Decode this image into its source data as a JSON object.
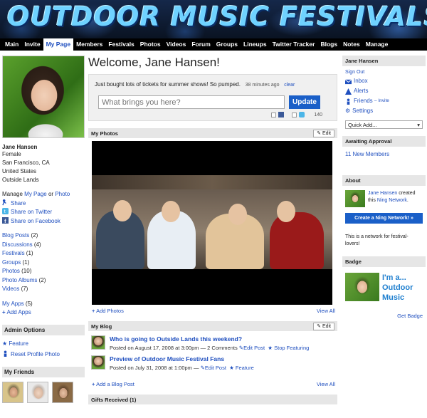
{
  "banner": {
    "title": "OUTDOOR MUSIC FESTIVALS"
  },
  "nav": [
    "Main",
    "Invite",
    "My Page",
    "Members",
    "Festivals",
    "Photos",
    "Videos",
    "Forum",
    "Groups",
    "Lineups",
    "Twitter Tracker",
    "Blogs",
    "Notes",
    "Manage"
  ],
  "nav_active": "My Page",
  "profile": {
    "name": "Jane Hansen",
    "gender": "Female",
    "city": "San Francisco, CA",
    "country": "United States",
    "extra": "Outside Lands",
    "manage_prefix": "Manage",
    "manage_page": "My Page",
    "manage_or": "or",
    "manage_photo": "Photo",
    "share": "Share",
    "share_twitter": "Share on Twitter",
    "share_facebook": "Share on Facebook"
  },
  "content_links": [
    {
      "label": "Blog Posts",
      "count": "(2)"
    },
    {
      "label": "Discussions",
      "count": "(4)"
    },
    {
      "label": "Festivals",
      "count": "(1)"
    },
    {
      "label": "Groups",
      "count": "(1)"
    },
    {
      "label": "Photos",
      "count": "(10)"
    },
    {
      "label": "Photo Albums",
      "count": "(2)"
    },
    {
      "label": "Videos",
      "count": "(7)"
    }
  ],
  "apps": {
    "my_apps": "My Apps",
    "my_apps_count": "(5)",
    "add_apps": "Add Apps"
  },
  "admin": {
    "title": "Admin Options",
    "feature": "Feature",
    "reset": "Reset Profile Photo"
  },
  "friends": {
    "title": "My Friends"
  },
  "welcome": "Welcome, Jane Hansen!",
  "status": {
    "text": "Just bought lots of tickets for summer shows! So pumped.",
    "time": "38 minutes ago",
    "clear": "clear",
    "placeholder": "What brings you here?",
    "update": "Update",
    "count": "140"
  },
  "photos_module": {
    "title": "My Photos",
    "edit": "Edit",
    "add": "Add Photos",
    "view_all": "View All"
  },
  "blog_module": {
    "title": "My Blog",
    "edit": "Edit",
    "add": "Add a Blog Post",
    "view_all": "View All",
    "posts": [
      {
        "title": "Who is going to Outside Lands this weekend?",
        "meta": "Posted on August 17, 2008 at 3:00pm — 2 Comments",
        "edit": "Edit Post",
        "feature": "Stop Featuring"
      },
      {
        "title": "Preview of Outdoor Music Festival Fans",
        "meta": "Posted on July 31, 2008 at 1:00pm —",
        "edit": "Edit Post",
        "feature": "Feature"
      }
    ]
  },
  "gifts": {
    "title": "Gifts Received (1)"
  },
  "right": {
    "user_title": "Jane Hansen",
    "sign_out": "Sign Out",
    "inbox": "Inbox",
    "alerts": "Alerts",
    "friends": "Friends",
    "invite": "– Invite",
    "settings": "Settings",
    "quick_add": "Quick Add...",
    "awaiting_title": "Awaiting Approval",
    "new_members": "11 New Members",
    "about_title": "About",
    "about_user": "Jane Hansen",
    "about_created": "created this",
    "about_network": "Ning Network",
    "create_btn": "Create a Ning Network! »",
    "about_desc": "This is a network for festival-lovers!",
    "badge_title": "Badge",
    "badge_text_1": "I'm a...",
    "badge_text_2": "Outdoor",
    "badge_text_3": "Music",
    "get_badge": "Get Badge"
  }
}
